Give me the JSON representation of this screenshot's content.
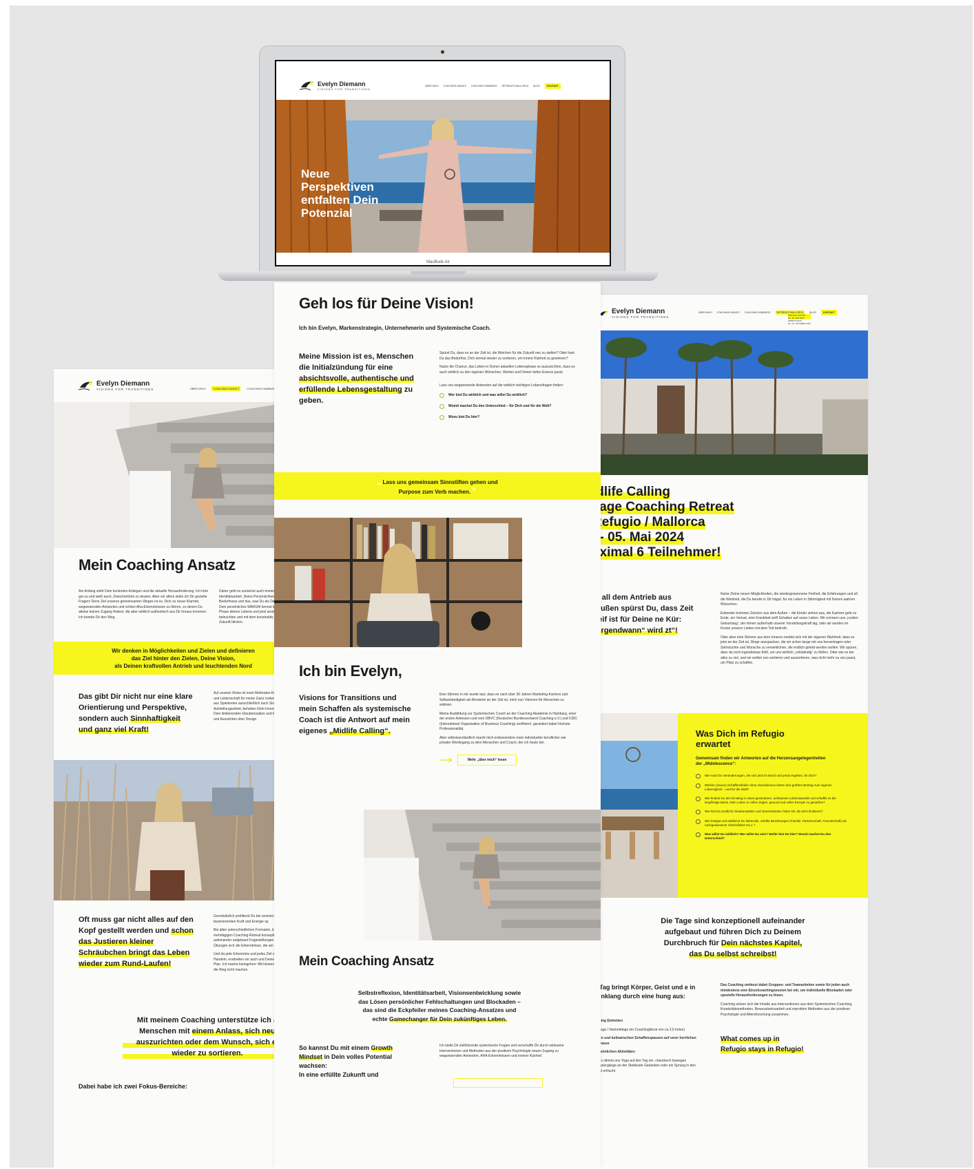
{
  "brand": {
    "name": "Evelyn Diemann",
    "tagline": "VISIONS FOR TRANSITIONS"
  },
  "nav": {
    "items": [
      "ÜBER MICH",
      "COACHING ANSATZ",
      "COACHING HAMBURG",
      "RETREATS MALLORCA",
      "BLOG"
    ],
    "cta": "KONTAKT"
  },
  "colors": {
    "accent": "#f6f61c",
    "text": "#1b1b1b",
    "background": "#e6e6e6"
  },
  "laptop": {
    "model": "MacBook Air",
    "hero_title": [
      "Neue",
      "Perspektiven",
      "entfalten Dein",
      "Potenzial"
    ]
  },
  "center": {
    "heading": "Geh los für Deine Vision!",
    "intro": "Ich bin Evelyn, Markenstrategin, Unternehmerin und Systemische Coach.",
    "mission_lead": "Meine Mission ist es, Menschen die Initialzündung für eine",
    "mission_hl": "absichtsvolle, authentische und erfüllende Lebensgestaltung",
    "mission_tail": "zu geben.",
    "side_paras": [
      "Spürst Du, dass es an der Zeit ist, die Weichen für die Zukunft neu zu stellen? Oder hast Du das Bedürfnis, Dich einmal wieder zu sortieren, um innere Klarheit zu gewinnen?",
      "Nutze die Chance, das Leben in Deiner aktuellen Lebensphase so auszurichten, dass es auch wirklich zu den eigenen Wünschen, Werten und Deiner tiefen Essenz passt.",
      "Lass uns wegweisende Antworten auf die wirklich wichtigen Lebensfragen finden:"
    ],
    "questions": [
      "Wer bist Du wirklich und was willst Du wirklich?",
      "Womit machst Du den Unterschied – für Dich und für die Welt?",
      "Wozu bist Du hier?"
    ],
    "quote": [
      "Lass uns gemeinsam Sinnstiften gehen und",
      "Purpose zum Verb machen."
    ],
    "ich_bin": "Ich bin Evelyn,",
    "visions_lead": "Visions for Transitions und mein Schaffen als systemische Coach ist die Antwort auf mein eigenes",
    "visions_hl": "„Midlife Calling“.",
    "bio_paras": [
      "Eine Stimme in mir wurde laut, dass es nach über 30 Jahren Marketing-Karriere und Selbstständigkeit als Beraterin an der Zeit ist, mich nun Visionen für Menschen zu widmen.",
      "Meine Ausbildung zur Systemischen Coach an der Coaching Akademie in Hamburg, einer der ersten Adressen und vom DBVC (Deutscher Bundesverband Coaching e.V.) und ICBC (International Organisation of Business Coaching) zertifiziert, garantiert dabei höchste Professionalität.",
      "Aber selbstverständlich macht mich insbesondere mein individueller beruflicher wie privater Werdegang zu dem Menschen und Coach, der ich heute bin."
    ],
    "more_button": "Mehr „über mich“ lesen",
    "coaching_heading": "Mein Coaching Ansatz",
    "coaching_text": [
      "Selbstreflexion, Identitätsarbeit, Visionsentwicklung sowie",
      "das Lösen persönlicher Fehlschaltungen und Blockaden –",
      "das sind die Eckpfeiler meines Coaching-Ansatzes und"
    ],
    "coaching_text_tail": "echte",
    "coaching_hl": "Gamechanger für Dein zukünftiges Leben.",
    "growth_lead": "So kannst Du mit einem",
    "growth_hl": "Growth Mindset",
    "growth_tail": "in Dein volles Potential wachsen:",
    "growth_last": "In eine erfüllte Zukunft und",
    "growth_para": "Ich stelle Dir zielführende systemische Fragen und verschaffe Dir durch wirksame Interventionen und Methoden aus der positiven Psychologie neuen Zugang zu wegweisenden Antworten, AHA-Erkenntnissen und innerer Klarheit."
  },
  "left": {
    "heading": "Mein Coaching Ansatz",
    "para1": "Am Anfang steht Dein konkretes Anliegen und die aktuelle Herausforderung. Ich höre gut zu und weiß auch, Zwischentöne zu deuten. Aber vor allem stelle ich Dir gezielte Fragen! Denn Ziel unseres gemeinsamen Weges ist es, Dich zu neuer Klarheit, wegweisenden Antworten und echten Aha-Erkenntnissen zu führen, zu denen Du alleine keinen Zugang findest, die aber wirklich authentisch aus Dir heraus kommen. Ich bereite Dir den Weg.",
    "para2": "Daher geht es zunächst auch immer um Identitätsarbeit. Deine Persönlichkeit, Bedürfnisse und das, was Du als Dein oder Dein persönliches WARUM kennst in aktuellen Phase deines Lebens und jetzt anstellt, beleuchten und mit dem konstruktiv in die Zukunft blicken.",
    "quote": [
      "Wir denken in Möglichkeiten und Zielen und definieren",
      "das Ziel hinter den Zielen, Deine Vision,",
      "als Deinen kraftvollen Antrieb und leuchtenden Nord"
    ],
    "gibt_lead": "Das gibt Dir nicht nur eine klare Orientierung und Perspektive, sondern auch",
    "gibt_hl": "Sinnhaftigkeit und ganz viel Kraft!",
    "gibt_para": "Auf unserer Reise ist mein Methoden-Kreativität und Leidenschaft für meine Ganz individuell, recht aus Spielereien ausschließlich nach Sinnhaftigkeit Aufstellungsarbeit, beheben Dein Inneres Kind, Dein limitierenden Glaubenssätze und Einsichten und Aussichten über Design",
    "kopf_lead": "Oft muss gar nicht alles auf den Kopf gestellt werden und",
    "kopf_hl": "schon das Justieren kleiner Schräubchen bringt das Leben wieder zum Rund-Laufen!",
    "kopf_paras": [
      "Grundsätzlich profitierst Du bei unseren faszinierenden Kraft und Energie sp",
      "Bei allen unterschiedlichen Formaten, bis zum mehrtägigen Coaching-Retreat konzeptionell aufeinander aufgebaut Fragestellungen, Coaching-Übungen sich die Erkenntnisse, die am Ende he",
      "Und da jede Erkenntnis und jedes Ziel abgeleitete Handeln, erarbeiten wir auch und Deinen Aktions-Plan. Ich mache kleingehen: Mit kleinen Schritten, die Weg nicht machen."
    ],
    "unterstuetze": [
      "Mit meinem Coaching unterstütze ich a",
      "Menschen mit",
      "einem Anlass, sich neu",
      "auszurichten oder dem Wunsch, sich ei",
      "wieder zu sortieren."
    ],
    "fokus": "Dabei habe ich zwei Fokus-Bereiche:"
  },
  "right": {
    "nav_sub": [
      "MIDLIFE CALLING",
      "01.–05. MAI 2024",
      "ORIENT DAYS",
      "06.–13. OKTOBER 2024"
    ],
    "retreat_title": [
      "idlife Calling",
      "Tage Coaching Retreat",
      "Refugio / Mallorca",
      ". - 05. Mai 2024",
      "aximal 6 Teilnehmer!"
    ],
    "antrieb_lead": "h all dem Antrieb aus Außen spürst Du, dass Zeit reif ist für Deine ne Kür:",
    "antrieb_hl": "„irgendwann“ wird zt“!",
    "antrieb_paras": [
      "Nutze Deine neuen Möglichkeiten, die wiedergewonnene Freiheit, die Erfahrungen und all die Weisheit, die Du bereits in Dir trägst, für ein Leben in Stimmigkeit mit Deinen wahren Wünschen.",
      "Entweder kommen Zeichen aus dem Außen – die Kinder ziehen aus, die Karriere geht zu Ende, ein Verlust, eine Krankheit wirft Schatten auf unser Leben. Wir erinnern uns „runden Geburtstag“, der immer außerhalb unserer Vorstellungskraft lag, oder wir werden im Kreise unserer Lieben mit dem Tod bedroht.",
      "Oder aber eine Stimme aus dem Inneren meldet sich mit der eigenen Wahrheit, dass es jetzt an der Zeit ist, Dinge anzupacken, die wir schon lange mit uns herumtragen oder Sehnsüchte und Wünsche zu verwirklichen, die endlich gelebt werden wollen. Wir spüren, dass da noch irgendetwas fehlt, um uns wirklich „vollständig“ zu fühlen. Oder wie es bei alles zu viel, und wir wollen uns sortieren und aussortieren, was nicht mehr zu uns passt, um Platz zu schaffen."
    ],
    "erwartet_title": "Was Dich im Refugio erwartet",
    "erwartet_lead": "Gemeinsam finden wir Antworten auf die Herzensangelegenheiten der „Midolescence“:",
    "erwartet_items": [
      "Wie nutzt Du Veränderungen, die sich jetzt im Beruf und privat ergeben, für Dich?",
      "Welche (neuen) Schaffensfelder ohne Absolutismus bieten den größten Beitrag zum eigenen Lebensglück – und für die Welt?",
      "Wie findest Du den Einstieg in einen gesünderen, achtsamen Lebenswandel und schaffst so die langfristige Basis, Dein Leben in vollen Zügen, gesund und voller Energie zu genießen?",
      "Wie löst Du (endlich) Glaubenssätze und Gewohnheiten hinter Dir, die Dich limitieren?",
      "Wie festigst und etablierst Du liebevolle, erfüllte Beziehungen (Familie, Partnerschaft, Freundschaft) als nachgewiesener Glücksfaktor No.1 ?",
      "Was willst Du wirklich? Wer willst Du sein? Wofür bist Du hier? Womit machst Du den Unterschied?"
    ],
    "tage_lead": [
      "Die Tage sind konzeptionell aufeinander",
      "aufgebaut und führen Dich zu Deinem",
      "Durchbruch für"
    ],
    "tage_hl": "Dein nächstes Kapitel,",
    "tage_hl2": "das Du selbst schreibst!",
    "tag_text": "r Tag bringt Körper, Geist und e in Einklang durch eine hung aus:",
    "tag_items": [
      "aching Einheiten",
      "mittags / Nachmittags ein Coachingblock von ca 2,5 inden)",
      "tiven und kulinarischen Schaffenspausen auf serer herrlichen Terrasse",
      "persönlichen Aktivitäten",
      "gens stimmt uns Yoga auf den Tag ein. chendurch bewegen Spaziergänge an der Steilküste Gedanken oder ein Sprung in den Pool erfrischt"
    ],
    "coaching_para": [
      "Das Coaching umfasst dabei Gruppen- und Teamarbeiten sowie für jeden auch mindestens eine Einzelcoachingsession bei mir, um individuelle Blockaden oder spezielle Herausforderungen zu lösen.",
      "Coaching setzen sich die Inhalte aus Interventionen aus dem Systemischen Coaching, Kreativitätsmethoden, Bewusstseinsarbeit und erprobten Methoden aus der positiven Psychologie und Altersforschung zusammen."
    ],
    "comes_up": [
      "What comes up in",
      "Refugio stays in Refugio!"
    ]
  }
}
